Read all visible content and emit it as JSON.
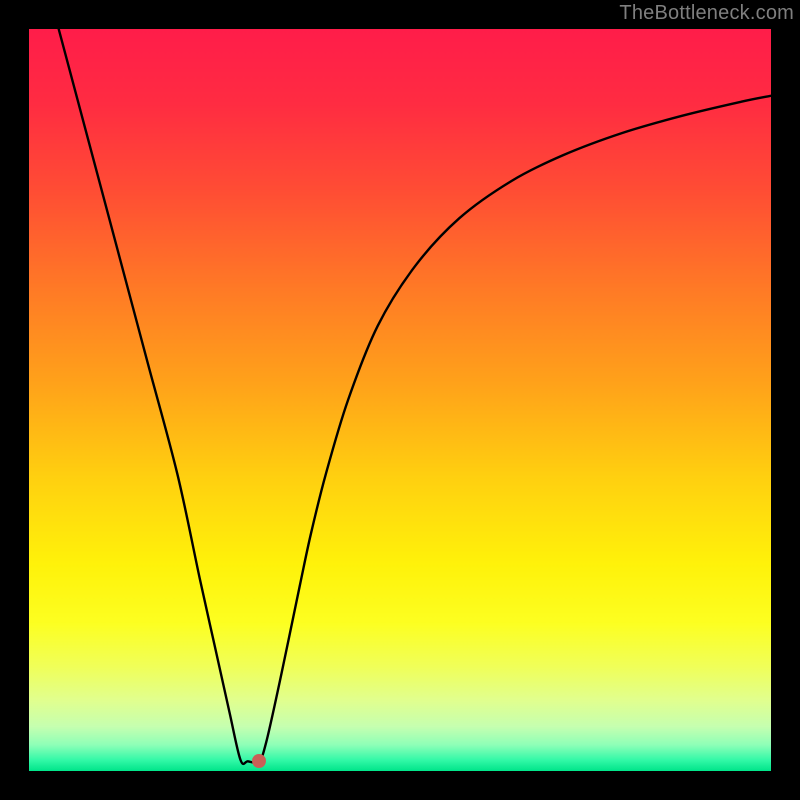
{
  "watermark": "TheBottleneck.com",
  "chart_data": {
    "type": "line",
    "title": "",
    "xlabel": "",
    "ylabel": "",
    "xlim": [
      0,
      100
    ],
    "ylim": [
      0,
      100
    ],
    "grid": false,
    "series": [
      {
        "name": "curve",
        "x": [
          4,
          8,
          12,
          16,
          20,
          23,
          25,
          27,
          28.5,
          29.5,
          31,
          32,
          34,
          36.5,
          38,
          40,
          43,
          47,
          52,
          58,
          65,
          72,
          80,
          88,
          96,
          100
        ],
        "y": [
          100,
          85,
          70,
          55,
          40,
          26,
          17,
          8,
          1.5,
          1.3,
          1.3,
          4,
          13,
          25,
          32,
          40,
          50,
          60,
          68,
          74.5,
          79.5,
          83,
          86,
          88.3,
          90.2,
          91
        ]
      }
    ],
    "marker": {
      "x": 31,
      "y": 1.3
    },
    "background_gradient": {
      "stops": [
        {
          "pos": 0.0,
          "color": "#ff1d4a"
        },
        {
          "pos": 0.1,
          "color": "#ff2c42"
        },
        {
          "pos": 0.22,
          "color": "#ff4e34"
        },
        {
          "pos": 0.35,
          "color": "#ff7a26"
        },
        {
          "pos": 0.48,
          "color": "#ffa31a"
        },
        {
          "pos": 0.6,
          "color": "#ffcf10"
        },
        {
          "pos": 0.72,
          "color": "#fff20a"
        },
        {
          "pos": 0.8,
          "color": "#fdff21"
        },
        {
          "pos": 0.86,
          "color": "#f0ff5a"
        },
        {
          "pos": 0.905,
          "color": "#e1ff8f"
        },
        {
          "pos": 0.94,
          "color": "#c6ffb0"
        },
        {
          "pos": 0.965,
          "color": "#8effb8"
        },
        {
          "pos": 0.985,
          "color": "#34f9a8"
        },
        {
          "pos": 1.0,
          "color": "#00e58a"
        }
      ]
    }
  }
}
